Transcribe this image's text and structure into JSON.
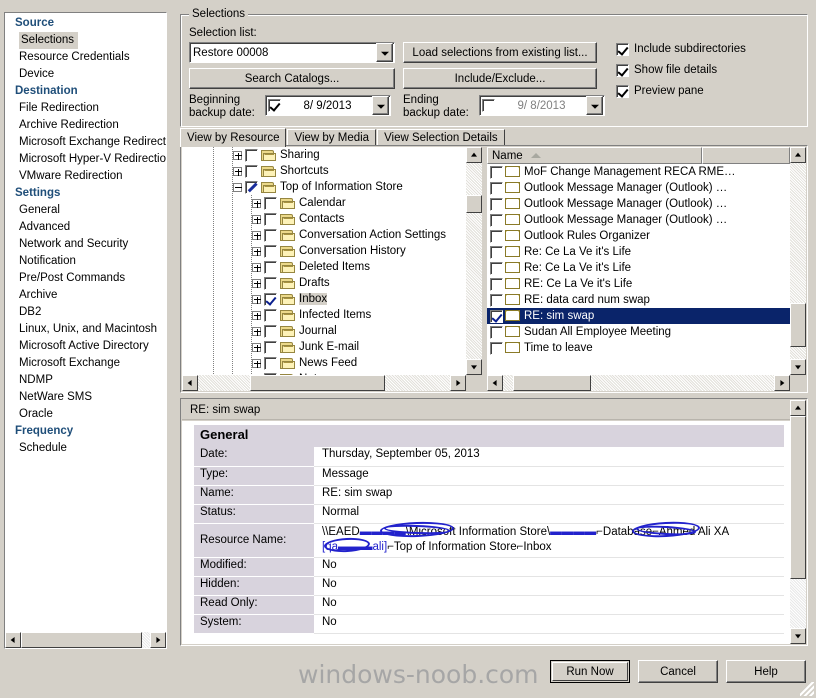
{
  "sidebar": {
    "groups": [
      {
        "title": "Source",
        "items": [
          {
            "label": "Selections",
            "selected": true
          },
          {
            "label": "Resource Credentials",
            "selected": false
          },
          {
            "label": "Device",
            "selected": false
          }
        ]
      },
      {
        "title": "Destination",
        "items": [
          {
            "label": "File Redirection",
            "selected": false
          },
          {
            "label": "Archive Redirection",
            "selected": false
          },
          {
            "label": "Microsoft Exchange Redirection",
            "selected": false
          },
          {
            "label": "Microsoft Hyper-V Redirection",
            "selected": false
          },
          {
            "label": "VMware Redirection",
            "selected": false
          }
        ]
      },
      {
        "title": "Settings",
        "items": [
          {
            "label": "General",
            "selected": false
          },
          {
            "label": "Advanced",
            "selected": false
          },
          {
            "label": "Network and Security",
            "selected": false
          },
          {
            "label": "Notification",
            "selected": false
          },
          {
            "label": "Pre/Post Commands",
            "selected": false
          },
          {
            "label": "Archive",
            "selected": false
          },
          {
            "label": "DB2",
            "selected": false
          },
          {
            "label": "Linux, Unix, and Macintosh",
            "selected": false
          },
          {
            "label": "Microsoft Active Directory",
            "selected": false
          },
          {
            "label": "Microsoft Exchange",
            "selected": false
          },
          {
            "label": "NDMP",
            "selected": false
          },
          {
            "label": "NetWare SMS",
            "selected": false
          },
          {
            "label": "Oracle",
            "selected": false
          }
        ]
      },
      {
        "title": "Frequency",
        "items": [
          {
            "label": "Schedule",
            "selected": false
          }
        ]
      }
    ]
  },
  "selections": {
    "group_title": "Selections",
    "selection_list_label": "Selection list:",
    "selection_list_value": "Restore 00008",
    "load_selections_button": "Load selections from existing list...",
    "search_catalogs_button": "Search Catalogs...",
    "include_exclude_button": "Include/Exclude...",
    "beginning_date_label_line1": "Beginning",
    "beginning_date_label_line2": "backup date:",
    "beginning_date_value": "8/  9/2013",
    "beginning_date_checked": true,
    "ending_date_label_line1": "Ending",
    "ending_date_label_line2": "backup date:",
    "ending_date_value": "9/  8/2013",
    "ending_date_checked": false,
    "options": [
      {
        "label": "Include subdirectories",
        "checked": true
      },
      {
        "label": "Show file details",
        "checked": true
      },
      {
        "label": "Preview pane",
        "checked": true
      }
    ]
  },
  "tabs": [
    {
      "label": "View by Resource",
      "active": true
    },
    {
      "label": "View by Media",
      "active": false
    },
    {
      "label": "View Selection Details",
      "active": false
    }
  ],
  "tree": {
    "nodes": [
      {
        "label": "Sharing",
        "indent": 3,
        "expander": "plus",
        "check": "empty"
      },
      {
        "label": "Shortcuts",
        "indent": 3,
        "expander": "plus",
        "check": "empty"
      },
      {
        "label": "Top of Information Store",
        "indent": 3,
        "expander": "minus",
        "check": "slash"
      },
      {
        "label": "Calendar",
        "indent": 4,
        "expander": "plus",
        "check": "empty"
      },
      {
        "label": "Contacts",
        "indent": 4,
        "expander": "plus",
        "check": "empty"
      },
      {
        "label": "Conversation Action Settings",
        "indent": 4,
        "expander": "plus",
        "check": "empty"
      },
      {
        "label": "Conversation History",
        "indent": 4,
        "expander": "plus",
        "check": "empty"
      },
      {
        "label": "Deleted Items",
        "indent": 4,
        "expander": "plus",
        "check": "empty"
      },
      {
        "label": "Drafts",
        "indent": 4,
        "expander": "plus",
        "check": "empty"
      },
      {
        "label": "Inbox",
        "indent": 4,
        "expander": "plus",
        "check": "checked",
        "selected": true
      },
      {
        "label": "Infected Items",
        "indent": 4,
        "expander": "plus",
        "check": "empty"
      },
      {
        "label": "Journal",
        "indent": 4,
        "expander": "plus",
        "check": "empty"
      },
      {
        "label": "Junk E-mail",
        "indent": 4,
        "expander": "plus",
        "check": "empty"
      },
      {
        "label": "News Feed",
        "indent": 4,
        "expander": "plus",
        "check": "empty"
      },
      {
        "label": "Notes",
        "indent": 4,
        "expander": "plus",
        "check": "empty"
      }
    ]
  },
  "filelist": {
    "column_header": "Name",
    "rows": [
      {
        "label": "MoF Change Management RECA RME…",
        "checked": false,
        "selected": false
      },
      {
        "label": "Outlook Message Manager (Outlook) …",
        "checked": false,
        "selected": false
      },
      {
        "label": "Outlook Message Manager (Outlook) …",
        "checked": false,
        "selected": false
      },
      {
        "label": "Outlook Message Manager (Outlook) …",
        "checked": false,
        "selected": false
      },
      {
        "label": "Outlook Rules Organizer",
        "checked": false,
        "selected": false
      },
      {
        "label": "Re: Ce La Ve it's Life",
        "checked": false,
        "selected": false
      },
      {
        "label": "Re: Ce La Ve it's Life",
        "checked": false,
        "selected": false
      },
      {
        "label": "RE: Ce La Ve it's Life",
        "checked": false,
        "selected": false
      },
      {
        "label": "RE: data card num swap",
        "checked": false,
        "selected": false
      },
      {
        "label": "RE: sim swap",
        "checked": true,
        "selected": true
      },
      {
        "label": "Sudan All Employee Meeting",
        "checked": false,
        "selected": false
      },
      {
        "label": "Time to leave",
        "checked": false,
        "selected": false
      }
    ]
  },
  "preview": {
    "title": "RE: sim swap",
    "section_header": "General",
    "rows": [
      {
        "key": "Date:",
        "value": "Thursday, September 05, 2013"
      },
      {
        "key": "Type:",
        "value": "Message"
      },
      {
        "key": "Name:",
        "value": "RE: sim swap"
      },
      {
        "key": "Status:",
        "value": "Normal"
      },
      {
        "key": "Modified:",
        "value": "No"
      },
      {
        "key": "Hidden:",
        "value": "No"
      },
      {
        "key": "Read Only:",
        "value": "No"
      },
      {
        "key": "System:",
        "value": "No"
      }
    ],
    "resource_name_key": "Resource Name:",
    "resource_name_line1_a": "\\\\EAED",
    "resource_name_line1_b": "\\Microsoft Information Store\\",
    "resource_name_line1_c": "⌐Database⌐Ahmed Ali XA",
    "resource_name_line2": "⌐Top of Information Store⌐Inbox",
    "resource_name_redacted_1": "▬▬▬▬",
    "resource_name_redacted_2": "▬▬▬▬",
    "resource_name_redacted_3": "[qa▬▬▬ali]"
  },
  "footer": {
    "watermark": "windows-noob.com",
    "buttons": [
      {
        "label": "Run Now",
        "default": true
      },
      {
        "label": "Cancel",
        "default": false
      },
      {
        "label": "Help",
        "default": false
      }
    ]
  },
  "colors": {
    "window_face": "#d4d0c8",
    "accent_heading": "#1f4e79",
    "selection_blue": "#0a246a",
    "section_header": "#d8d3dd",
    "redaction_ink": "#2222cc"
  }
}
